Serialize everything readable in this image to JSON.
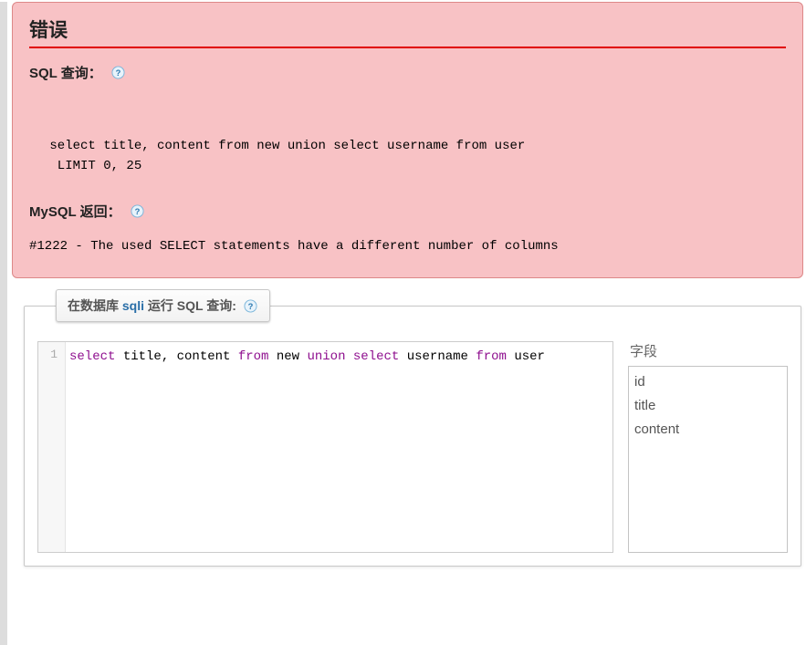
{
  "error": {
    "title": "错误",
    "sql_label": "SQL 查询：",
    "sql_text": " select title, content from new union select username from user\n  LIMIT 0, 25 ",
    "mysql_label": "MySQL 返回：",
    "message": "#1222 - The used SELECT statements have a different number of columns"
  },
  "editor": {
    "legend_prefix": "在数据库 ",
    "legend_db": "sqli",
    "legend_suffix": " 运行 SQL 查询:",
    "line_number": "1",
    "code_tokens": [
      {
        "t": "select",
        "c": "kw"
      },
      {
        "t": " title, content ",
        "c": "plain"
      },
      {
        "t": "from",
        "c": "kw"
      },
      {
        "t": " new ",
        "c": "plain"
      },
      {
        "t": "union",
        "c": "kw"
      },
      {
        "t": " ",
        "c": "plain"
      },
      {
        "t": "select",
        "c": "kw"
      },
      {
        "t": " username ",
        "c": "plain"
      },
      {
        "t": "from",
        "c": "kw"
      },
      {
        "t": " user",
        "c": "plain"
      }
    ],
    "fields_label": "字段",
    "fields": [
      "id",
      "title",
      "content"
    ]
  },
  "icons": {
    "help": "?"
  }
}
